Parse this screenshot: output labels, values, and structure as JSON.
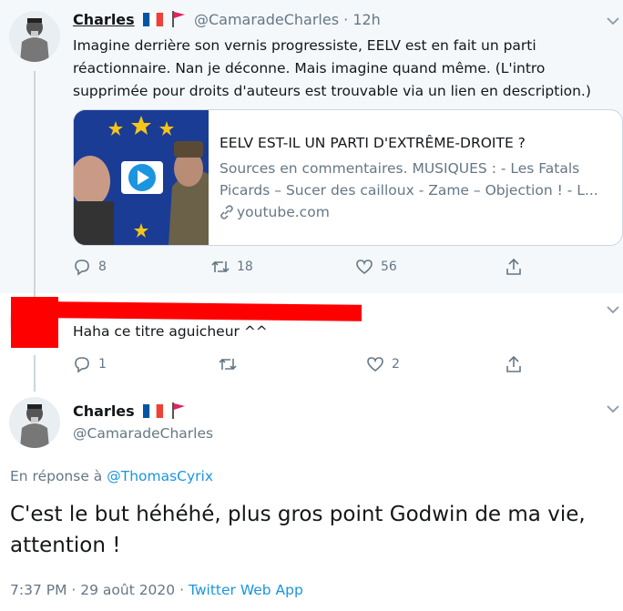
{
  "tweet1": {
    "name": "Charles",
    "handle": "@CamaradeCharles",
    "time": "· 12h",
    "text": "Imagine derrière son vernis progressiste, EELV est en fait un parti réactionnaire. Nan je déconne. Mais imagine quand même. (L'intro supprimée pour droits d'auteurs est trouvable via un lien en description.)",
    "card": {
      "title": "EELV EST-IL UN PARTI D'EXTRÊME-DROITE ?",
      "description": "Sources en commentaires. MUSIQUES : - Les Fatals Picards – Sucer des cailloux - Zame – Objection ! - L...",
      "domain": "youtube.com"
    },
    "replies": "8",
    "retweets": "18",
    "likes": "56"
  },
  "tweet2": {
    "text": "Haha ce titre aguicheur ^^",
    "replies": "1",
    "retweets": "",
    "likes": "2"
  },
  "tweet3": {
    "name": "Charles",
    "handle": "@CamaradeCharles",
    "reply_prefix": "En réponse à",
    "reply_to": "@ThomasCyrix",
    "text": "C'est le but héhéhé, plus gros point Godwin de ma vie, attention !",
    "timestamp": "7:37 PM · 29 août 2020 ·",
    "source": "Twitter Web App"
  },
  "colors": {
    "accent": "#1b95e0",
    "muted": "#657786",
    "redaction": "#ff0000"
  }
}
